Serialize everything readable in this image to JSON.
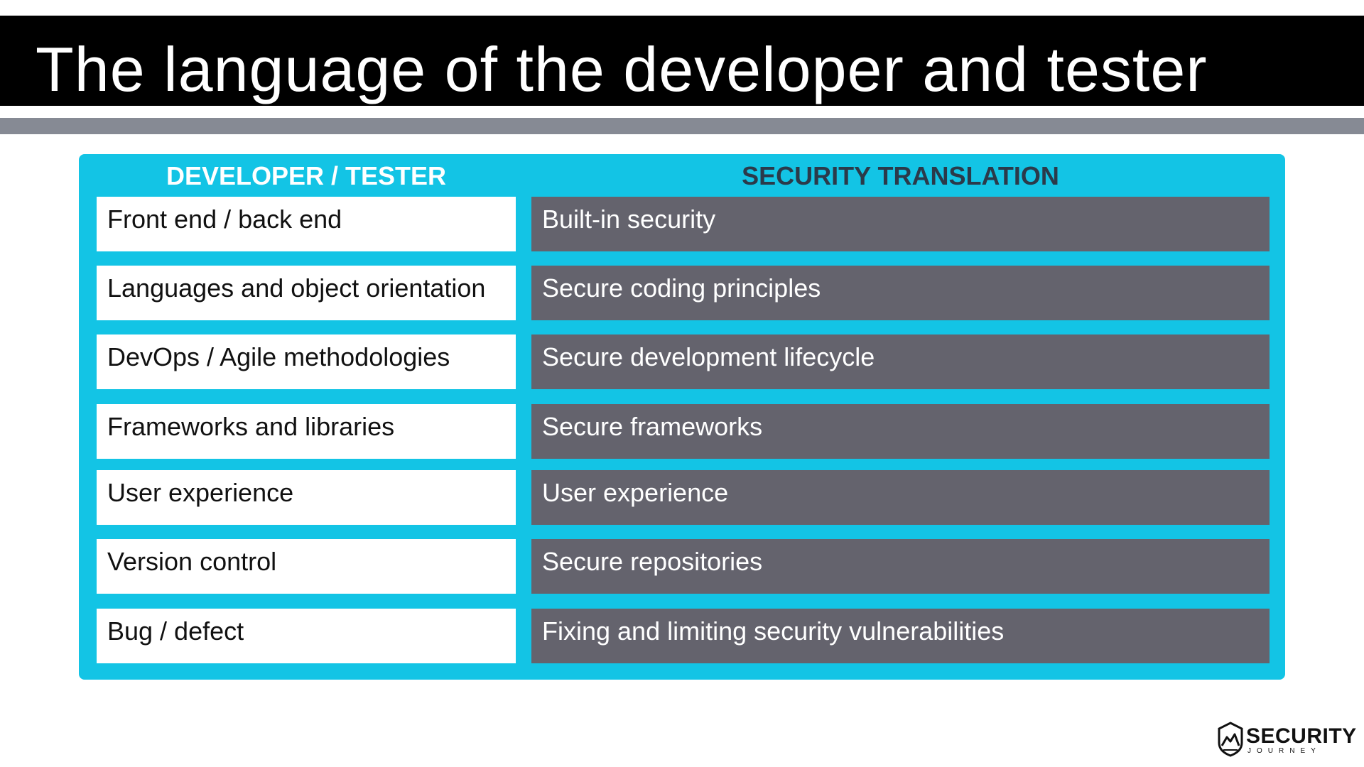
{
  "slide": {
    "title": "The language of the developer and tester"
  },
  "table": {
    "headers": {
      "left": "DEVELOPER / TESTER",
      "right": "SECURITY TRANSLATION"
    },
    "rows": [
      {
        "developer": "Front end / back end",
        "security": "Built-in security"
      },
      {
        "developer": "Languages and object orientation",
        "security": "Secure coding principles"
      },
      {
        "developer": "DevOps / Agile methodologies",
        "security": "Secure development lifecycle"
      },
      {
        "developer": "Frameworks and libraries",
        "security": "Secure frameworks"
      },
      {
        "developer": "User experience",
        "security": "User experience"
      },
      {
        "developer": "Version control",
        "security": "Secure repositories"
      },
      {
        "developer": "Bug / defect",
        "security": "Fixing and limiting security vulnerabilities"
      }
    ]
  },
  "logo": {
    "word": "SECURITY",
    "sub": "JOURNEY",
    "icon": "mountain-shield-icon"
  },
  "colors": {
    "title_bar": "#000000",
    "sub_bar": "#868a94",
    "panel": "#13c4e5",
    "right_cell": "#64636d",
    "right_header": "#2b3a4a"
  }
}
